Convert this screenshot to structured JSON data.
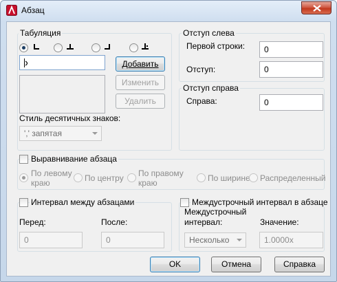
{
  "window": {
    "title": "Абзац"
  },
  "tabs_group": {
    "label": "Табуляция",
    "tab_input_value": "",
    "add_button": "Добавить",
    "edit_button": "Изменить",
    "delete_button": "Удалить",
    "decimal_style_label": "Стиль десятичных знаков:",
    "decimal_style_value": "',' запятая"
  },
  "indent_left": {
    "label": "Отступ слева",
    "first_line_label": "Первой строки:",
    "first_line_value": "0",
    "indent_label": "Отступ:",
    "indent_value": "0"
  },
  "indent_right": {
    "label": "Отступ справа",
    "right_label": "Справа:",
    "right_value": "0"
  },
  "alignment": {
    "label": "Выравнивание абзаца",
    "options": [
      "По левому\nкраю",
      "По центру",
      "По правому\nкраю",
      "По ширине",
      "Распределенный"
    ]
  },
  "paragraph_spacing": {
    "label": "Интервал между абзацами",
    "before_label": "Перед:",
    "before_value": "0",
    "after_label": "После:",
    "after_value": "0"
  },
  "line_spacing": {
    "label": "Междустрочный интервал в абзаце",
    "spacing_label": "Междустрочный\nинтервал:",
    "spacing_value": "Несколько",
    "value_label": "Значение:",
    "value_value": "1.0000x"
  },
  "buttons": {
    "ok": "OK",
    "cancel": "Отмена",
    "help": "Справка"
  },
  "colors": {
    "title_gradient": "#cfdeef",
    "close_button": "#c2391f",
    "dialog_bg": "#f0f0f0"
  }
}
